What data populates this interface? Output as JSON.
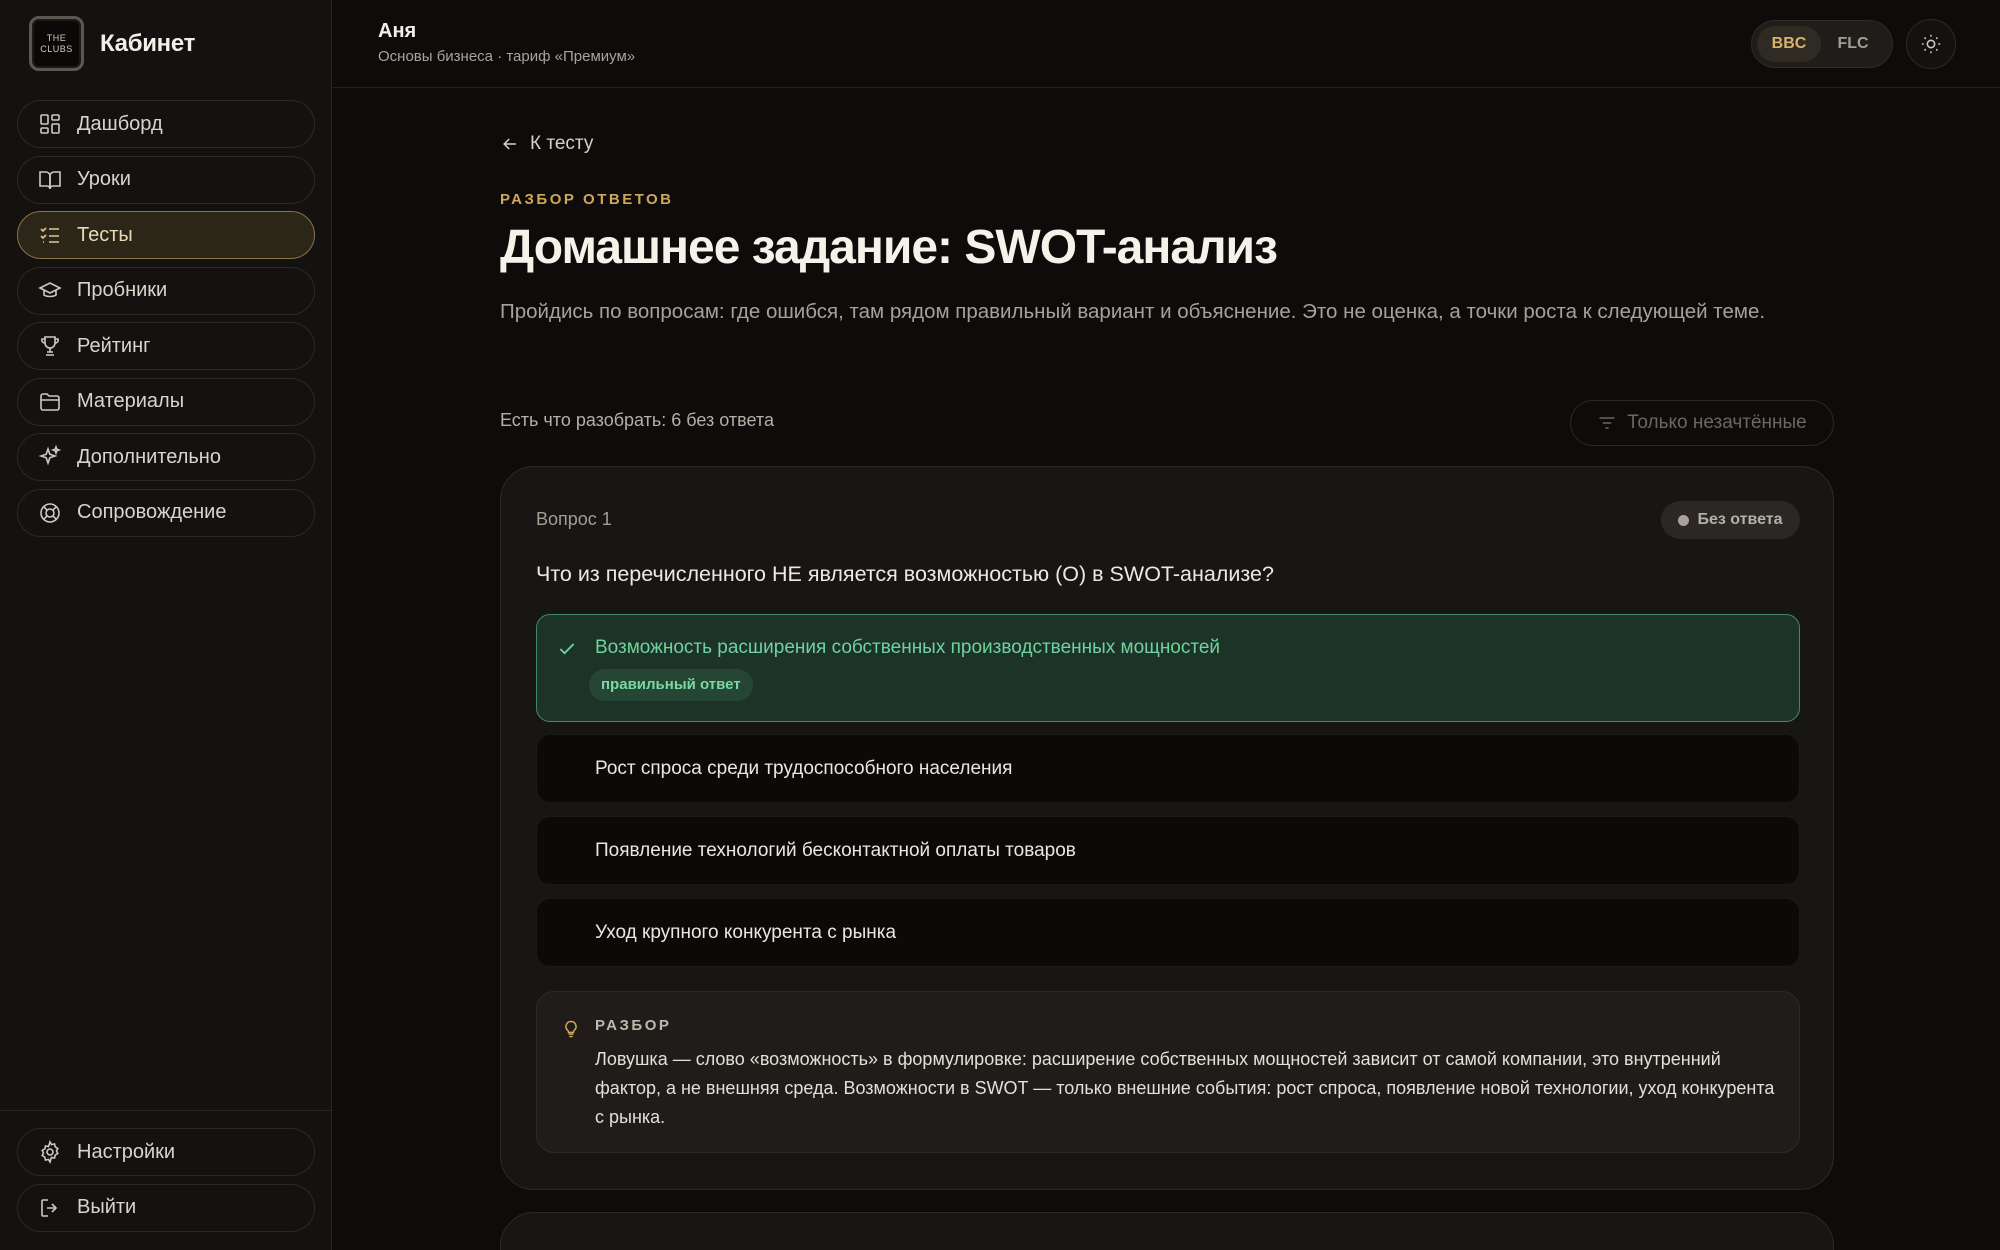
{
  "brand": {
    "logo_top": "THE",
    "logo_bottom": "CLUBS",
    "title": "Кабинет"
  },
  "sidebar": {
    "items": [
      {
        "label": "Дашборд",
        "icon": "dashboard-icon",
        "active": false
      },
      {
        "label": "Уроки",
        "icon": "book-icon",
        "active": false
      },
      {
        "label": "Тесты",
        "icon": "checklist-icon",
        "active": true
      },
      {
        "label": "Пробники",
        "icon": "graduation-cap-icon",
        "active": false
      },
      {
        "label": "Рейтинг",
        "icon": "trophy-icon",
        "active": false
      },
      {
        "label": "Материалы",
        "icon": "folder-icon",
        "active": false
      },
      {
        "label": "Дополнительно",
        "icon": "sparkles-icon",
        "active": false
      },
      {
        "label": "Сопровождение",
        "icon": "lifebuoy-icon",
        "active": false
      }
    ],
    "bottom": [
      {
        "label": "Настройки",
        "icon": "gear-icon"
      },
      {
        "label": "Выйти",
        "icon": "logout-icon"
      }
    ]
  },
  "header": {
    "user_name": "Аня",
    "user_sub": "Основы бизнеса · тариф «Премиум»",
    "switch": [
      "BBC",
      "FLC"
    ],
    "switch_active": "BBC"
  },
  "main": {
    "back_label": "К тесту",
    "eyebrow": "РАЗБОР ОТВЕТОВ",
    "title": "Домашнее задание: SWOT-анализ",
    "description": "Пройдись по вопросам: где ошибся, там рядом правильный вариант и объяснение. Это не оценка, а точки роста к следующей теме.",
    "summary": "Есть что разобрать: 6 без ответа",
    "filter_label": "Только незачтённые"
  },
  "question": {
    "number": "Вопрос 1",
    "status": "Без ответа",
    "text": "Что из перечисленного НЕ является возможностью (O) в SWOT-анализе?",
    "options": [
      {
        "text": "Возможность расширения собственных производственных мощностей",
        "correct": true,
        "tag": "правильный ответ"
      },
      {
        "text": "Рост спроса среди трудоспособного населения",
        "correct": false
      },
      {
        "text": "Появление технологий бесконтактной оплаты товаров",
        "correct": false
      },
      {
        "text": "Уход крупного конкурента с рынка",
        "correct": false
      }
    ],
    "explanation_label": "РАЗБОР",
    "explanation": "Ловушка — слово «возможность» в формулировке: расширение собственных мощностей зависит от самой компании, это внутренний фактор, а не внешняя среда. Возможности в SWOT — только внешние события: рост спроса, появление новой технологии, уход конкурента с рынка."
  },
  "colors": {
    "accent": "#cfa65c",
    "correct": "#6fd39d",
    "background": "#0d0c0b"
  }
}
